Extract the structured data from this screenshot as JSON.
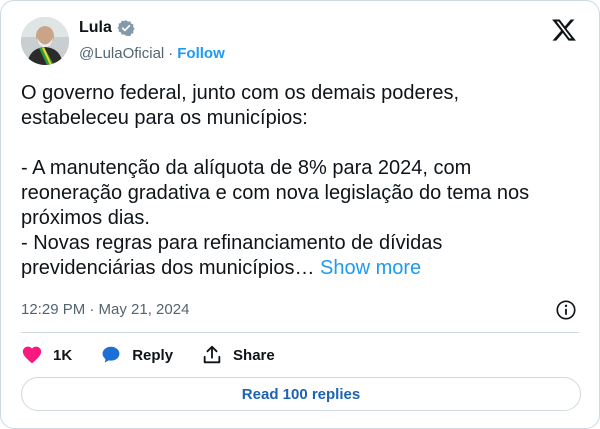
{
  "author": {
    "display_name": "Lula",
    "handle": "@LulaOficial",
    "separator": "·",
    "follow_label": "Follow",
    "verified_icon": "verified-badge-icon"
  },
  "brand": {
    "logo": "x-logo-icon"
  },
  "tweet": {
    "text": "O governo federal, junto com os demais poderes,\nestabeleceu para os municípios:\n\n- A manutenção da alíquota de 8% para 2024, com\nreoneração gradativa e com nova legislação do tema nos\npróximos dias.\n- Novas regras para refinanciamento de dívidas\nprevidenciárias dos municípios… ",
    "show_more": "Show more",
    "timestamp": "12:29 PM · May 21, 2024"
  },
  "actions": {
    "like_count": "1K",
    "reply_label": "Reply",
    "share_label": "Share"
  },
  "replies_button": "Read 100 replies",
  "colors": {
    "accent": "#1d9bf0",
    "like": "#f91880",
    "reply_icon": "#1d6fd6",
    "text": "#0f1419",
    "muted": "#536471"
  }
}
